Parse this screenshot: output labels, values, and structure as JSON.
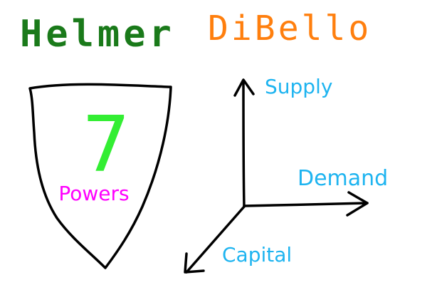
{
  "titles": {
    "left": "Helmer",
    "right": "DiBello"
  },
  "shield": {
    "number": "7",
    "label": "Powers"
  },
  "axes": {
    "vertical": "Supply",
    "horizontal": "Demand",
    "diagonal": "Capital"
  },
  "colors": {
    "left_title": "#1a7a1a",
    "right_title": "#ff7f0e",
    "shield_number": "#33ee33",
    "shield_label": "#ff00ff",
    "axis_labels": "#1eb4f0",
    "strokes": "#000000"
  }
}
